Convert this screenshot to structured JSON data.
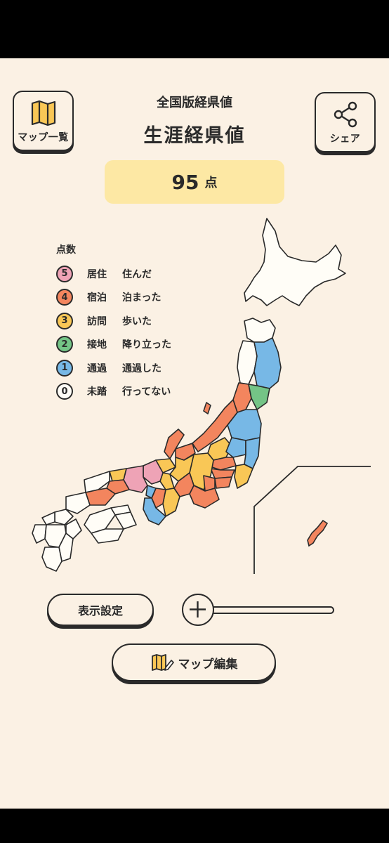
{
  "header": {
    "subtitle": "全国版経県値",
    "title": "生涯経県値",
    "map_list_label": "マップ一覧",
    "share_label": "シェア"
  },
  "score": {
    "value": "95",
    "unit": "点"
  },
  "legend": {
    "title": "点数",
    "items": [
      {
        "level": "5",
        "name": "居住",
        "desc": "住んだ",
        "color": "#eea3b6"
      },
      {
        "level": "4",
        "name": "宿泊",
        "desc": "泊まった",
        "color": "#f3855e"
      },
      {
        "level": "3",
        "name": "訪問",
        "desc": "歩いた",
        "color": "#f9c756"
      },
      {
        "level": "2",
        "name": "接地",
        "desc": "降り立った",
        "color": "#74c486"
      },
      {
        "level": "1",
        "name": "通過",
        "desc": "通過した",
        "color": "#77b8e6"
      },
      {
        "level": "0",
        "name": "未踏",
        "desc": "行ってない",
        "color": "#fffdf7"
      }
    ]
  },
  "controls": {
    "display_settings_label": "表示設定",
    "map_edit_label": "マップ編集",
    "zoom": 0
  }
}
